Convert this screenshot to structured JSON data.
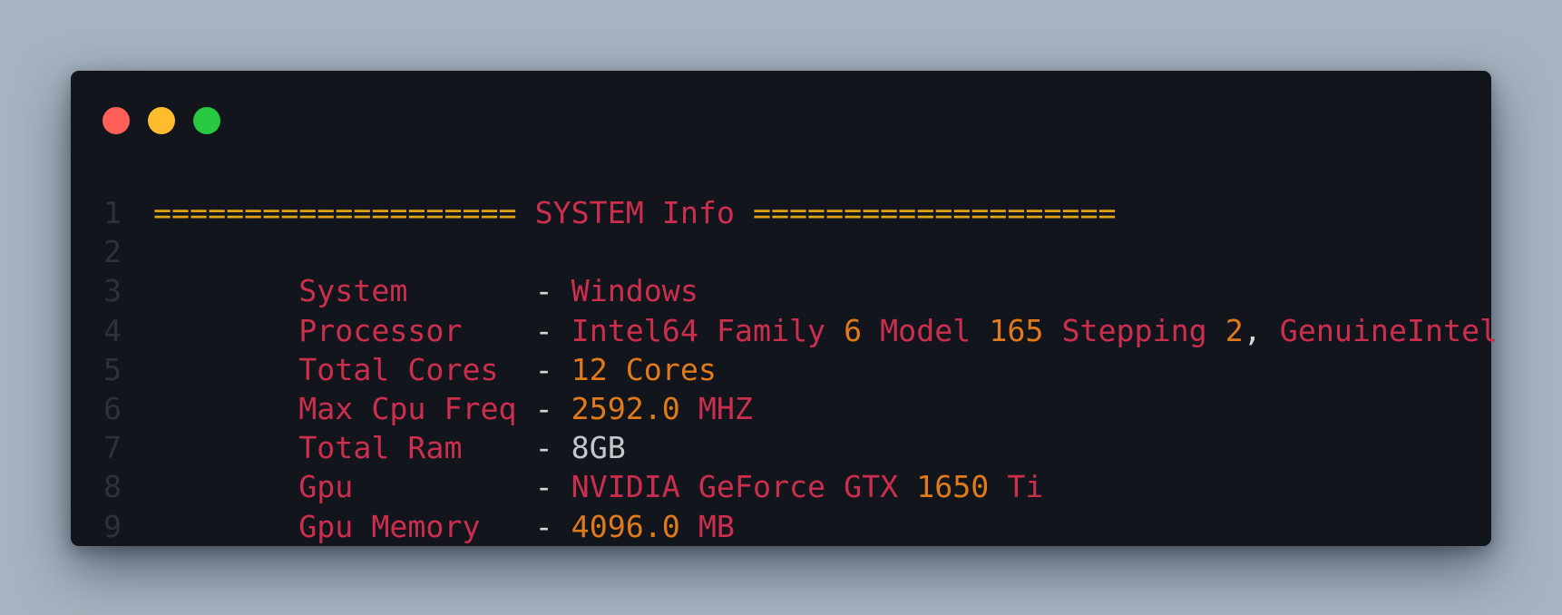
{
  "window": {
    "controls": [
      {
        "name": "close",
        "color": "#ff5f57"
      },
      {
        "name": "minimize",
        "color": "#febc2e"
      },
      {
        "name": "zoom",
        "color": "#28c840"
      }
    ]
  },
  "colors": {
    "keyword": "#cc2f4e",
    "number": "#e07a1a",
    "operator": "#d6d6d6",
    "plain": "#c4c8cc",
    "banner": "#e0a216",
    "line_number": "#2c313a",
    "background": "#12151b",
    "desktop": "#a7b3c0"
  },
  "code_lines": [
    {
      "number": "1",
      "tokens": [
        {
          "text": "====================",
          "kind": "banner"
        },
        {
          "text": " ",
          "kind": "plain"
        },
        {
          "text": "SYSTEM",
          "kind": "keyword"
        },
        {
          "text": " ",
          "kind": "plain"
        },
        {
          "text": "Info",
          "kind": "keyword"
        },
        {
          "text": " ",
          "kind": "plain"
        },
        {
          "text": "====================",
          "kind": "banner"
        }
      ]
    },
    {
      "number": "2",
      "tokens": []
    },
    {
      "number": "3",
      "tokens": [
        {
          "text": "        ",
          "kind": "plain"
        },
        {
          "text": "System      ",
          "kind": "keyword"
        },
        {
          "text": " - ",
          "kind": "operator"
        },
        {
          "text": "Windows",
          "kind": "keyword"
        }
      ]
    },
    {
      "number": "4",
      "tokens": [
        {
          "text": "        ",
          "kind": "plain"
        },
        {
          "text": "Processor   ",
          "kind": "keyword"
        },
        {
          "text": " - ",
          "kind": "operator"
        },
        {
          "text": "Intel64 Family ",
          "kind": "keyword"
        },
        {
          "text": "6",
          "kind": "number"
        },
        {
          "text": " Model ",
          "kind": "keyword"
        },
        {
          "text": "165",
          "kind": "number"
        },
        {
          "text": " Stepping ",
          "kind": "keyword"
        },
        {
          "text": "2",
          "kind": "number"
        },
        {
          "text": ", ",
          "kind": "operator"
        },
        {
          "text": "GenuineIntel",
          "kind": "keyword"
        }
      ]
    },
    {
      "number": "5",
      "tokens": [
        {
          "text": "        ",
          "kind": "plain"
        },
        {
          "text": "Total Cores ",
          "kind": "keyword"
        },
        {
          "text": " - ",
          "kind": "operator"
        },
        {
          "text": "12 Cores",
          "kind": "number"
        }
      ]
    },
    {
      "number": "6",
      "tokens": [
        {
          "text": "        ",
          "kind": "plain"
        },
        {
          "text": "Max Cpu Freq",
          "kind": "keyword"
        },
        {
          "text": " - ",
          "kind": "operator"
        },
        {
          "text": "2592.0",
          "kind": "number"
        },
        {
          "text": " MHZ",
          "kind": "keyword"
        }
      ]
    },
    {
      "number": "7",
      "tokens": [
        {
          "text": "        ",
          "kind": "plain"
        },
        {
          "text": "Total Ram   ",
          "kind": "keyword"
        },
        {
          "text": " - ",
          "kind": "operator"
        },
        {
          "text": "8GB",
          "kind": "plain"
        }
      ]
    },
    {
      "number": "8",
      "tokens": [
        {
          "text": "        ",
          "kind": "plain"
        },
        {
          "text": "Gpu         ",
          "kind": "keyword"
        },
        {
          "text": " - ",
          "kind": "operator"
        },
        {
          "text": "NVIDIA GeForce GTX ",
          "kind": "keyword"
        },
        {
          "text": "1650",
          "kind": "number"
        },
        {
          "text": " Ti",
          "kind": "keyword"
        }
      ]
    },
    {
      "number": "9",
      "tokens": [
        {
          "text": "        ",
          "kind": "plain"
        },
        {
          "text": "Gpu Memory  ",
          "kind": "keyword"
        },
        {
          "text": " - ",
          "kind": "operator"
        },
        {
          "text": "4096.0",
          "kind": "number"
        },
        {
          "text": " MB",
          "kind": "keyword"
        }
      ]
    }
  ]
}
